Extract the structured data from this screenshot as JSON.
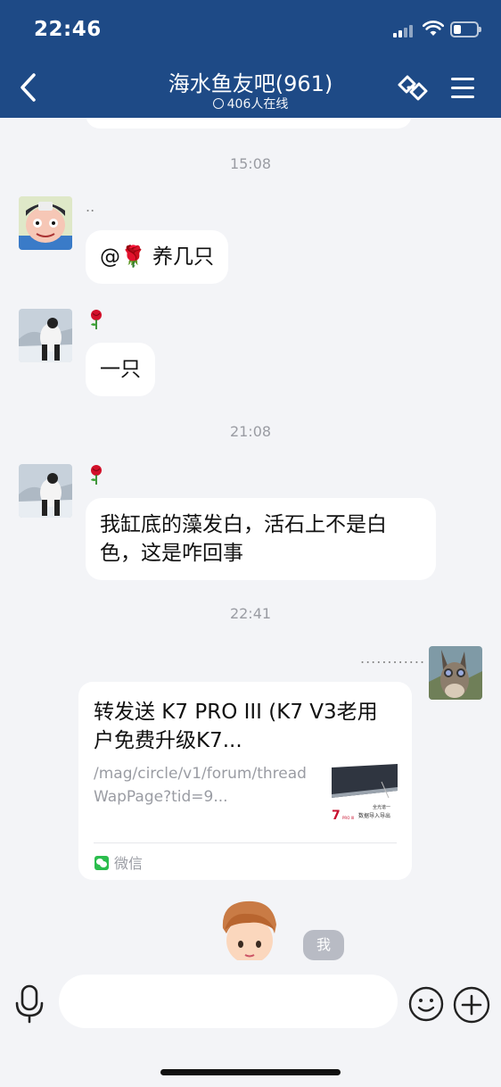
{
  "status_bar": {
    "time": "22:46"
  },
  "header": {
    "title": "海水鱼友吧(961)",
    "online_text": "406人在线"
  },
  "messages": [
    {
      "time": "15:08",
      "nickname": "..",
      "text": "@🌹 养几只"
    },
    {
      "nickname_emoji": "rose",
      "text": "一只"
    },
    {
      "time": "21:08",
      "nickname_emoji": "rose",
      "text": "我缸底的藻发白，活石上不是白色，这是咋回事"
    },
    {
      "time": "22:41",
      "nickname": "............",
      "card": {
        "title": "转发送 K7 PRO III (K7 V3老用户免费升级K7...",
        "url": "/mag/circle/v1/forum/threadWapPage?tid=9...",
        "source": "微信",
        "thumb_brand": "7",
        "thumb_model": "PRO III",
        "thumb_caption_1": "全光谱一",
        "thumb_caption_2": "数据导入导出"
      }
    },
    {
      "badge": "我"
    }
  ],
  "input": {
    "placeholder": ""
  },
  "colors": {
    "header_bg": "#1e4a86",
    "chat_bg": "#f3f4f7",
    "bubble_bg": "#ffffff",
    "wechat_green": "#2bbd4d"
  }
}
